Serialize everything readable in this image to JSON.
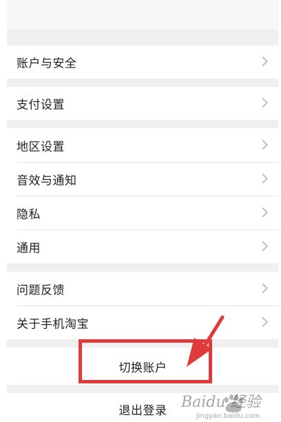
{
  "settings": {
    "groups": [
      {
        "items": [
          {
            "label": "账户与安全"
          }
        ]
      },
      {
        "items": [
          {
            "label": "支付设置"
          }
        ]
      },
      {
        "items": [
          {
            "label": "地区设置"
          },
          {
            "label": "音效与通知"
          },
          {
            "label": "隐私"
          },
          {
            "label": "通用"
          }
        ]
      },
      {
        "items": [
          {
            "label": "问题反馈"
          },
          {
            "label": "关于手机淘宝"
          }
        ]
      }
    ],
    "switch_account_label": "切换账户",
    "logout_label": "退出登录"
  },
  "overlay": {
    "highlight_color": "#e03a3a"
  },
  "watermark": {
    "text": "Baidu 经验",
    "url": "jingyan.baidu.com"
  }
}
